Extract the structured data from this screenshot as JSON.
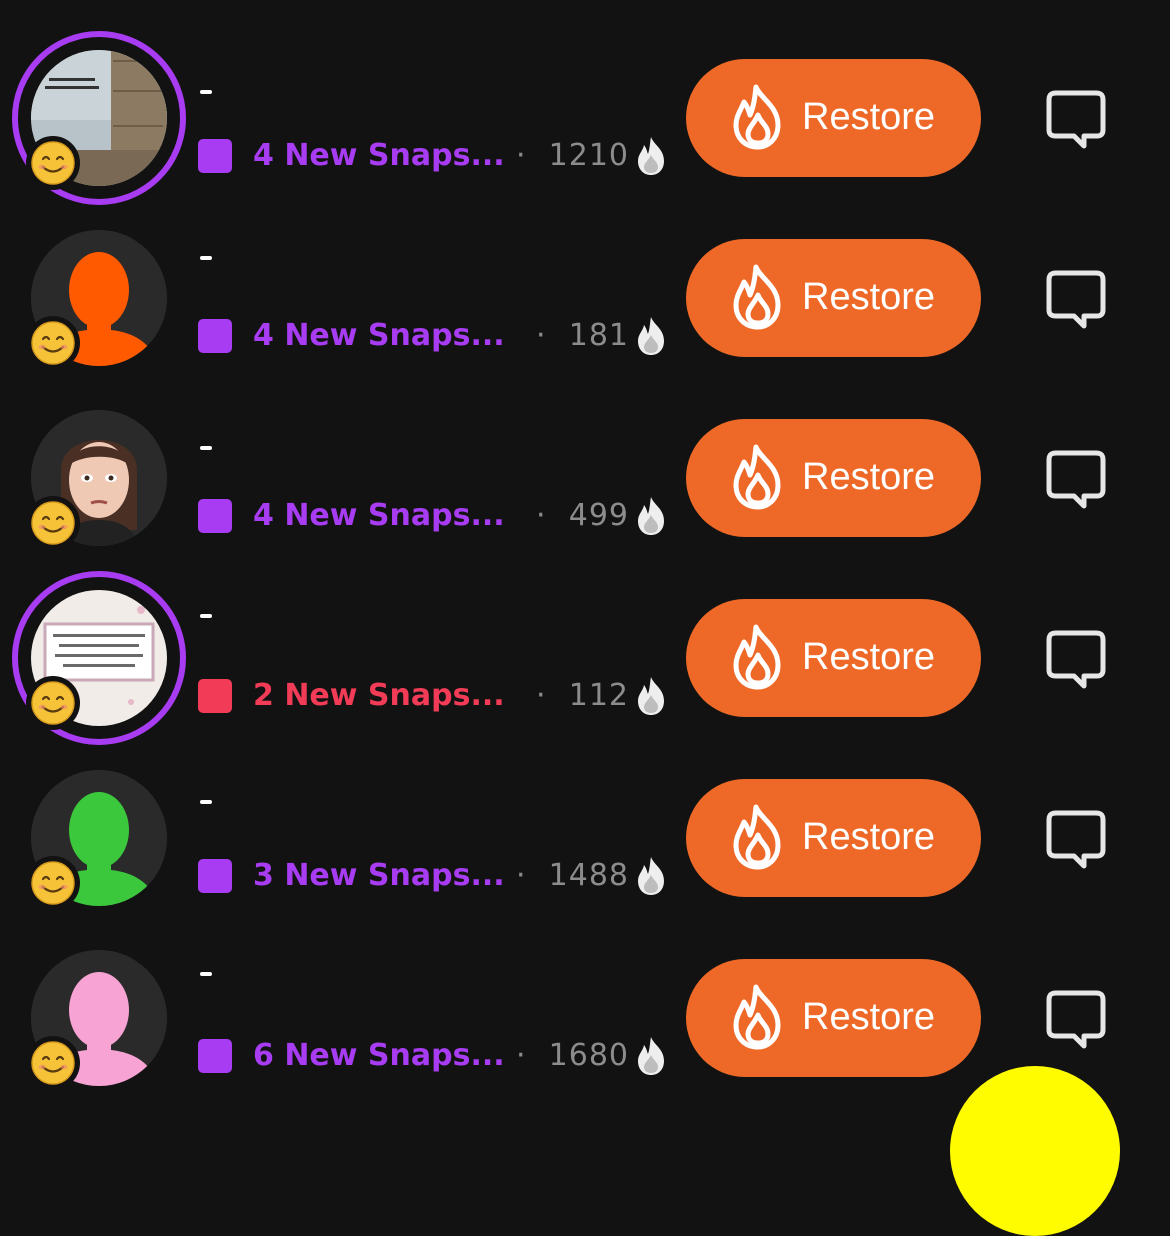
{
  "colors": {
    "background": "#121212",
    "accent_purple": "#a83cf2",
    "accent_red": "#f23c57",
    "restore_orange": "#ee6928",
    "count_gray": "#8c8c8c",
    "fab_yellow": "#fffc00"
  },
  "friends": [
    {
      "avatar": "photo-building-sky",
      "story_ring": true,
      "status_icon": "purple-square",
      "status_color": "#a83cf2",
      "status_text": "4 New Snaps...",
      "separator": "·",
      "streak_count": "1210",
      "streak_icon": "fire-emoji",
      "restore_label": "Restore",
      "chat_icon": "chat-bubble-icon"
    },
    {
      "avatar": "silhouette-orange",
      "avatar_color": "#ff5a00",
      "story_ring": false,
      "status_icon": "purple-square",
      "status_color": "#a83cf2",
      "status_text": "4 New Snaps...",
      "separator": "·",
      "streak_count": "181",
      "streak_icon": "fire-emoji",
      "restore_label": "Restore",
      "chat_icon": "chat-bubble-icon"
    },
    {
      "avatar": "bitmoji-woman",
      "story_ring": false,
      "status_icon": "purple-square",
      "status_color": "#a83cf2",
      "status_text": "4 New Snaps...",
      "separator": "·",
      "streak_count": "499",
      "streak_icon": "fire-emoji",
      "restore_label": "Restore",
      "chat_icon": "chat-bubble-icon"
    },
    {
      "avatar": "photo-framed-text",
      "story_ring": true,
      "status_icon": "red-square",
      "status_color": "#f23c57",
      "status_text": "2 New Snaps...",
      "separator": "·",
      "streak_count": "112",
      "streak_icon": "fire-emoji",
      "restore_label": "Restore",
      "chat_icon": "chat-bubble-icon"
    },
    {
      "avatar": "silhouette-green",
      "avatar_color": "#3cc83c",
      "story_ring": false,
      "status_icon": "purple-square",
      "status_color": "#a83cf2",
      "status_text": "3 New Snaps...",
      "separator": "·",
      "streak_count": "1488",
      "streak_icon": "fire-emoji",
      "restore_label": "Restore",
      "chat_icon": "chat-bubble-icon"
    },
    {
      "avatar": "silhouette-pink",
      "avatar_color": "#f7a3d3",
      "story_ring": false,
      "status_icon": "purple-square",
      "status_color": "#a83cf2",
      "status_text": "6 New Snaps...",
      "separator": "·",
      "streak_count": "1680",
      "streak_icon": "fire-emoji",
      "restore_label": "Restore",
      "chat_icon": "chat-bubble-icon"
    }
  ],
  "emoji_badge": "smiling-face-emoji",
  "camera_button_icon": "yellow-camera-button"
}
